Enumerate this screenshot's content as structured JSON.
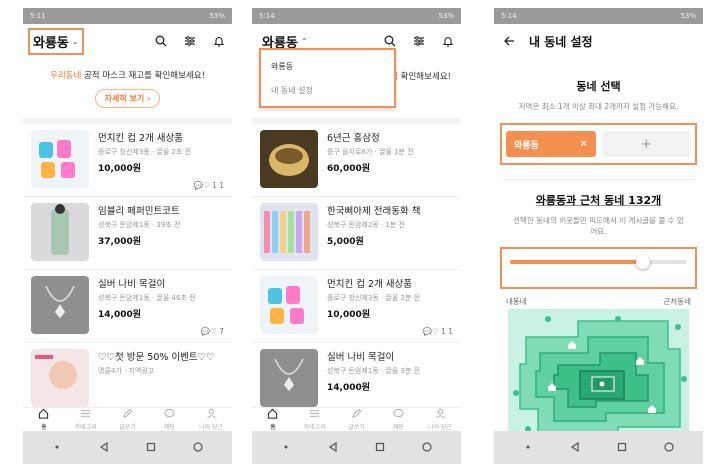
{
  "status": {
    "time_1": "5:11",
    "time_2": "5:14",
    "time_3": "5:14",
    "battery": "53%"
  },
  "colors": {
    "accent": "#f48f52",
    "orange_text": "#f07c2f",
    "map_bg": "#bfeee0",
    "map_green": "#3cbf8a"
  },
  "screen1": {
    "location": "와룡동",
    "banner_highlight": "우리동네",
    "banner_text": " 공적 마스크 재고를 확인해보세요!",
    "banner_button": "자세히 보기",
    "items": [
      {
        "title": "먼치킨 컵 2개 새상품",
        "meta": "종로구 창신제3동 · 끌올 2초 전",
        "price": "10,000원",
        "counts": "1 1",
        "thumb": "t-cups",
        "icon": "cups-thumbnail"
      },
      {
        "title": "임블리 페퍼민트코트",
        "meta": "성북구 돈암제1동 · 39초 전",
        "price": "37,000원",
        "counts": "",
        "thumb": "t-coat",
        "icon": "coat-thumbnail"
      },
      {
        "title": "실버 나비 목걸이",
        "meta": "성북구 돈암제1동 · 끌올 46초 전",
        "price": "14,000원",
        "counts": "7",
        "thumb": "t-neck",
        "icon": "necklace-thumbnail"
      },
      {
        "title": "♡♡첫 방문 50% 이벤트♡♡",
        "meta": "명륜4가 · 지역광고",
        "price": "",
        "counts": "",
        "thumb": "t-face",
        "icon": "ad-thumbnail"
      }
    ]
  },
  "screen2": {
    "location": "와룡동",
    "banner_text": "마스크 재고를 확인해보세요!",
    "dropdown": [
      "와룡동",
      "내 동네 설정"
    ],
    "items": [
      {
        "title": "6년근 홍삼정",
        "meta": "중구 을지로6가 · 끌올 1분 전",
        "price": "60,000원",
        "counts": "",
        "thumb": "t-jar",
        "icon": "jar-thumbnail"
      },
      {
        "title": "한국삐아제 전래동화 책",
        "meta": "성북구 돈암제2동 · 1분 전",
        "price": "5,000원",
        "counts": "",
        "thumb": "t-books",
        "icon": "books-thumbnail"
      },
      {
        "title": "먼치킨 컵 2개 새상품",
        "meta": "종로구 창신제3동 · 끌올 2분 전",
        "price": "10,000원",
        "counts": "1 1",
        "thumb": "t-cups",
        "icon": "cups-thumbnail"
      },
      {
        "title": "실버 나비 목걸이",
        "meta": "성북구 돈암제1동 · 끌올 3분 전",
        "price": "14,000원",
        "counts": "",
        "thumb": "t-neck",
        "icon": "necklace-thumbnail"
      }
    ]
  },
  "nav": [
    "홈",
    "카테고리",
    "글쓰기",
    "채팅",
    "나의 당근"
  ],
  "screen3": {
    "title": "내 동네 설정",
    "select_title": "동네 선택",
    "select_sub": "지역은 최소 1개 이상 최대 2개까지 설정 가능해요.",
    "chip": "와룡동",
    "chip_close": "×",
    "add": "+",
    "near_title": "와룡동과 근처 동네 132개",
    "near_sub": "선택한 동네의 이웃들만 피드에서 이 게시글을 볼 수 있어요.",
    "slider_near": "내동네",
    "slider_far": "근처동네",
    "slider_level": 0.75
  }
}
